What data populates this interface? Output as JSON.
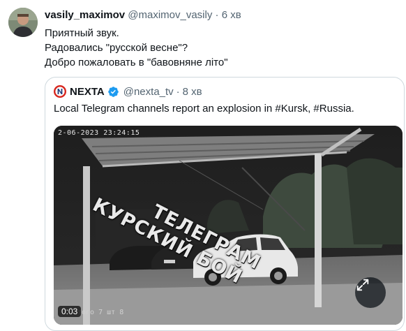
{
  "author": {
    "display_name": "vasily_maximov",
    "handle": "@maximov_vasily",
    "separator": "·",
    "time": "6 хв"
  },
  "tweet_text": {
    "line1": "Приятный звук.",
    "line2": "Радовались \"русской весне\"?",
    "line3": "Добро пожаловать в \"бавовняне літо\""
  },
  "quoted": {
    "display_name": "NEXTA",
    "handle": "@nexta_tv",
    "separator": "·",
    "time": "8 хв",
    "text": "Local Telegram channels report an explosion in #Kursk, #Russia.",
    "video": {
      "camera_timestamp": "2-06-2023 23:24:15",
      "bottom_overlay": "того 7 шт 8",
      "watermark_line1": "ТЕЛЕГРАМ",
      "watermark_line2": "КУРСКИЙ БОЙ",
      "elapsed": "0:03"
    }
  },
  "colors": {
    "text_primary": "#0f1419",
    "text_secondary": "#536471",
    "border": "#cfd9de",
    "verified_blue": "#1d9bf0",
    "nexta_red": "#d7261e"
  },
  "icons": [
    "avatar",
    "nexta-logo",
    "verified-badge-icon",
    "expand-icon"
  ]
}
